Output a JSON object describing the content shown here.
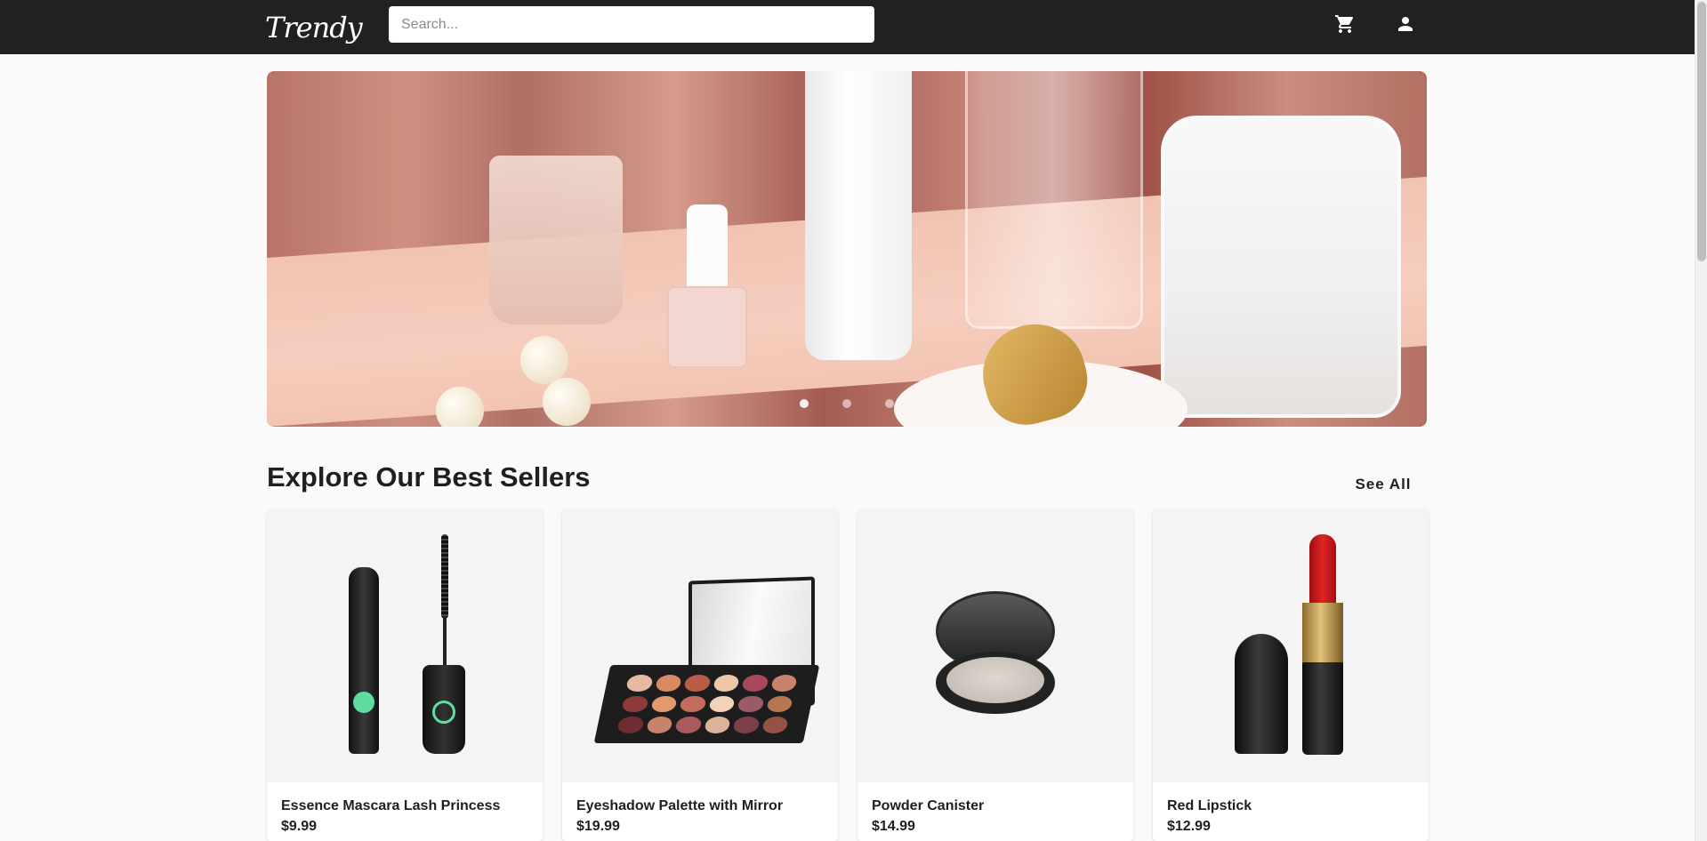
{
  "header": {
    "logo": "Trendy",
    "search_placeholder": "Search...",
    "cart_icon": "cart-icon",
    "account_icon": "user-icon"
  },
  "hero": {
    "slide_count": 3,
    "active_slide": 1
  },
  "best_sellers": {
    "title": "Explore Our Best Sellers",
    "see_all_label": "See All",
    "products": [
      {
        "name": "Essence Mascara Lash Princess",
        "price": "$9.99"
      },
      {
        "name": "Eyeshadow Palette with Mirror",
        "price": "$19.99"
      },
      {
        "name": "Powder Canister",
        "price": "$14.99"
      },
      {
        "name": "Red Lipstick",
        "price": "$12.99"
      }
    ]
  },
  "colors": {
    "header_bg": "#212121",
    "page_bg": "#fafafa",
    "card_media_bg": "#f4f4f4"
  }
}
